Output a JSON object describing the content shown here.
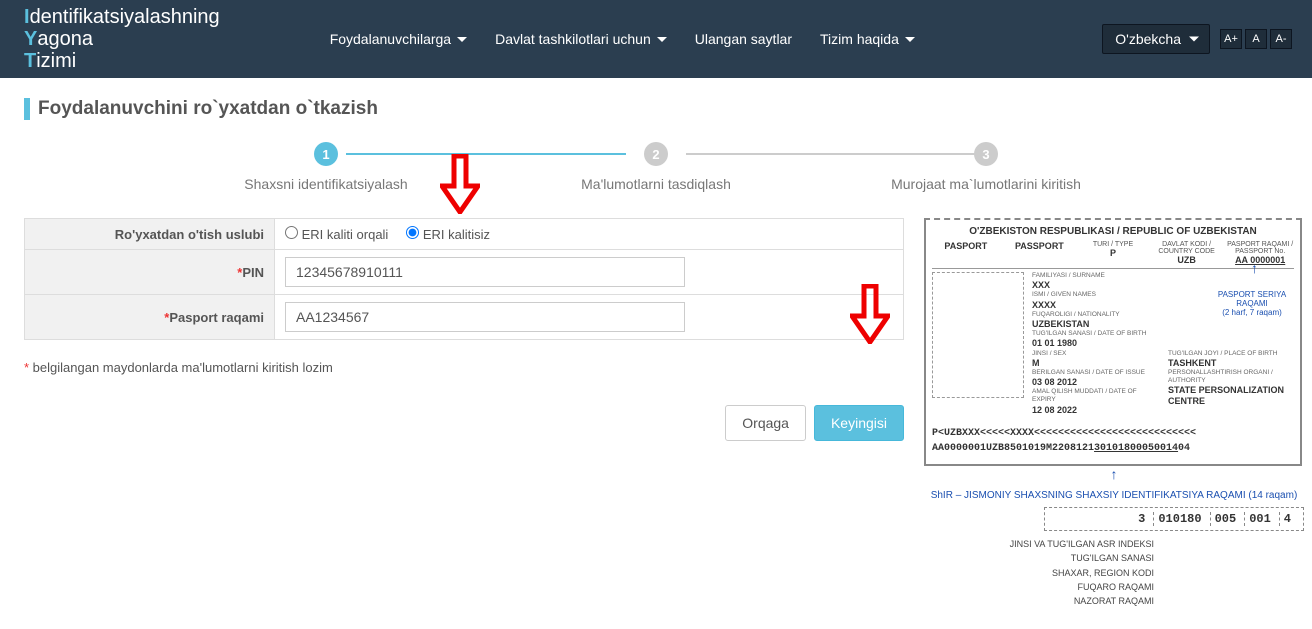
{
  "header": {
    "logo_line1_cap": "I",
    "logo_line1_rest": "dentifikatsiyalashning",
    "logo_line2_cap": "Y",
    "logo_line2_rest": "agona",
    "logo_line3_cap": "T",
    "logo_line3_rest": "izimi",
    "nav": {
      "users": "Foydalanuvchilarga",
      "gov": "Davlat tashkilotlari uchun",
      "sites": "Ulangan saytlar",
      "about": "Tizim haqida"
    },
    "language": "O'zbekcha",
    "font_inc": "A+",
    "font_norm": "A",
    "font_dec": "A-"
  },
  "page": {
    "title": "Foydalanuvchini ro`yxatdan o`tkazish"
  },
  "stepper": {
    "s1_num": "1",
    "s1_label": "Shaxsni identifikatsiyalash",
    "s2_num": "2",
    "s2_label": "Ma'lumotlarni tasdiqlash",
    "s3_num": "3",
    "s3_label": "Murojaat ma`lumotlarini kiritish"
  },
  "form": {
    "method_label": "Ro'yxatdan o'tish uslubi",
    "method_opt1": "ERI kaliti orqali",
    "method_opt2": "ERI kalitisiz",
    "pin_label": "PIN",
    "pin_value": "12345678910111",
    "passport_label": "Pasport raqami",
    "passport_value": "AA1234567",
    "required_mark": "*",
    "hint": " belgilangan maydonlarda ma'lumotlarni kiritish lozim",
    "btn_back": "Orqaga",
    "btn_next": "Keyingisi"
  },
  "passport": {
    "title": "O'ZBEKISTON RESPUBLIKASI / REPUBLIC OF UZBEKISTAN",
    "h_passport": "PASPORT",
    "h_passport_en": "PASSPORT",
    "h_type_lbl": "TURI / TYPE",
    "h_type_val": "P",
    "h_country_lbl": "DAVLAT KODI / COUNTRY CODE",
    "h_country_val": "UZB",
    "h_no_lbl": "PASPORT RAQAMI / PASSPORT No.",
    "h_no_val": "AA 0000001",
    "surname_lbl": "FAMILIYASI / SURNAME",
    "surname_val": "XXX",
    "given_lbl": "ISMI / GIVEN NAMES",
    "given_val": "XXXX",
    "nat_lbl": "FUQAROLIGI / NATIONALITY",
    "nat_val": "UZBEKISTAN",
    "dob_lbl": "TUG'ILGAN SANASI / DATE OF BIRTH",
    "dob_val": "01   01   1980",
    "sex_lbl": "JINSI / SEX",
    "sex_val": "M",
    "pob_lbl": "TUG'ILGAN JOYI / PLACE OF BIRTH",
    "pob_val": "TASHKENT",
    "doi_lbl": "BERILGAN SANASI / DATE OF ISSUE",
    "doi_val": "03   08   2012",
    "doe_lbl": "AMAL QILISH MUDDATI / DATE OF EXPIRY",
    "doe_val": "12   08   2022",
    "auth_lbl": "PERSONALLASHTIRISH ORGANI / AUTHORITY",
    "auth_val": "STATE PERSONALIZATION CENTRE",
    "seriya_note": "PASPORT SERIYA RAQAMI",
    "seriya_sub": "(2 harf, 7 raqam)",
    "mrz1": "P<UZBXXX<<<<<XXXX<<<<<<<<<<<<<<<<<<<<<<<<<<<",
    "mrz2a": "AA0000001UZB8501019M2208121",
    "mrz2b": "30101800050014",
    "mrz2c": "04",
    "shir_note": "ShIR – JISMONIY SHAXSNING SHAXSIY IDENTIFIKATSIYA RAQAMI (14 raqam)",
    "pin_parts": [
      "3",
      "010180",
      "005",
      "001",
      "4"
    ],
    "label_jinsi": "JINSI VA TUG'ILGAN ASR INDEKSI",
    "label_sana": "TUG'ILGAN SANASI",
    "label_region": "SHAXAR, REGION KODI",
    "label_fuqaro": "FUQARO RAQAMI",
    "label_nazorat": "NAZORAT RAQAMI"
  }
}
